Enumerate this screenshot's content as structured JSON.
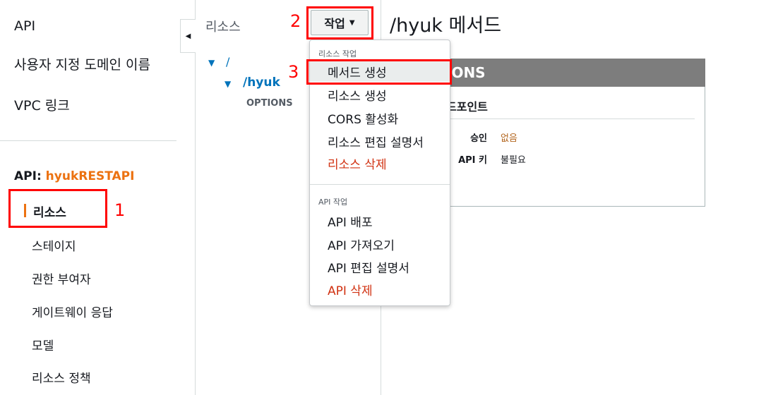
{
  "sidebar": {
    "top_items": [
      "API",
      "사용자 지정 도메인 이름",
      "VPC 링크"
    ],
    "api_label": "API:",
    "api_name": "hyukRESTAPI",
    "sub_items": [
      "리소스",
      "스테이지",
      "권한 부여자",
      "게이트웨이 응답",
      "모델",
      "리소스 정책"
    ]
  },
  "resources": {
    "title": "리소스",
    "actions_label": "작업",
    "tree": {
      "root": "/",
      "child": "/hyuk",
      "method": "OPTIONS"
    }
  },
  "main": {
    "title": "/hyuk 메서드",
    "card_header": "IONS",
    "card_subtitle": "드포인트",
    "rows": [
      {
        "label": "승인",
        "value": "없음"
      },
      {
        "label": "API 키",
        "value": "불필요"
      }
    ]
  },
  "dropdown": {
    "section1": "리소스 작업",
    "items1": [
      "메서드 생성",
      "리소스 생성",
      "CORS 활성화",
      "리소스 편집 설명서",
      "리소스 삭제"
    ],
    "section2": "API 작업",
    "items2": [
      "API 배포",
      "API 가져오기",
      "API 편집 설명서",
      "API 삭제"
    ]
  },
  "annotations": {
    "step1": "1",
    "step2": "2",
    "step3": "3"
  },
  "colors": {
    "accent_orange": "#ec7211",
    "link_blue": "#0073bb",
    "danger_red": "#d13212",
    "annotation_red": "#ff0000",
    "card_header_gray": "#7d7d7d"
  }
}
